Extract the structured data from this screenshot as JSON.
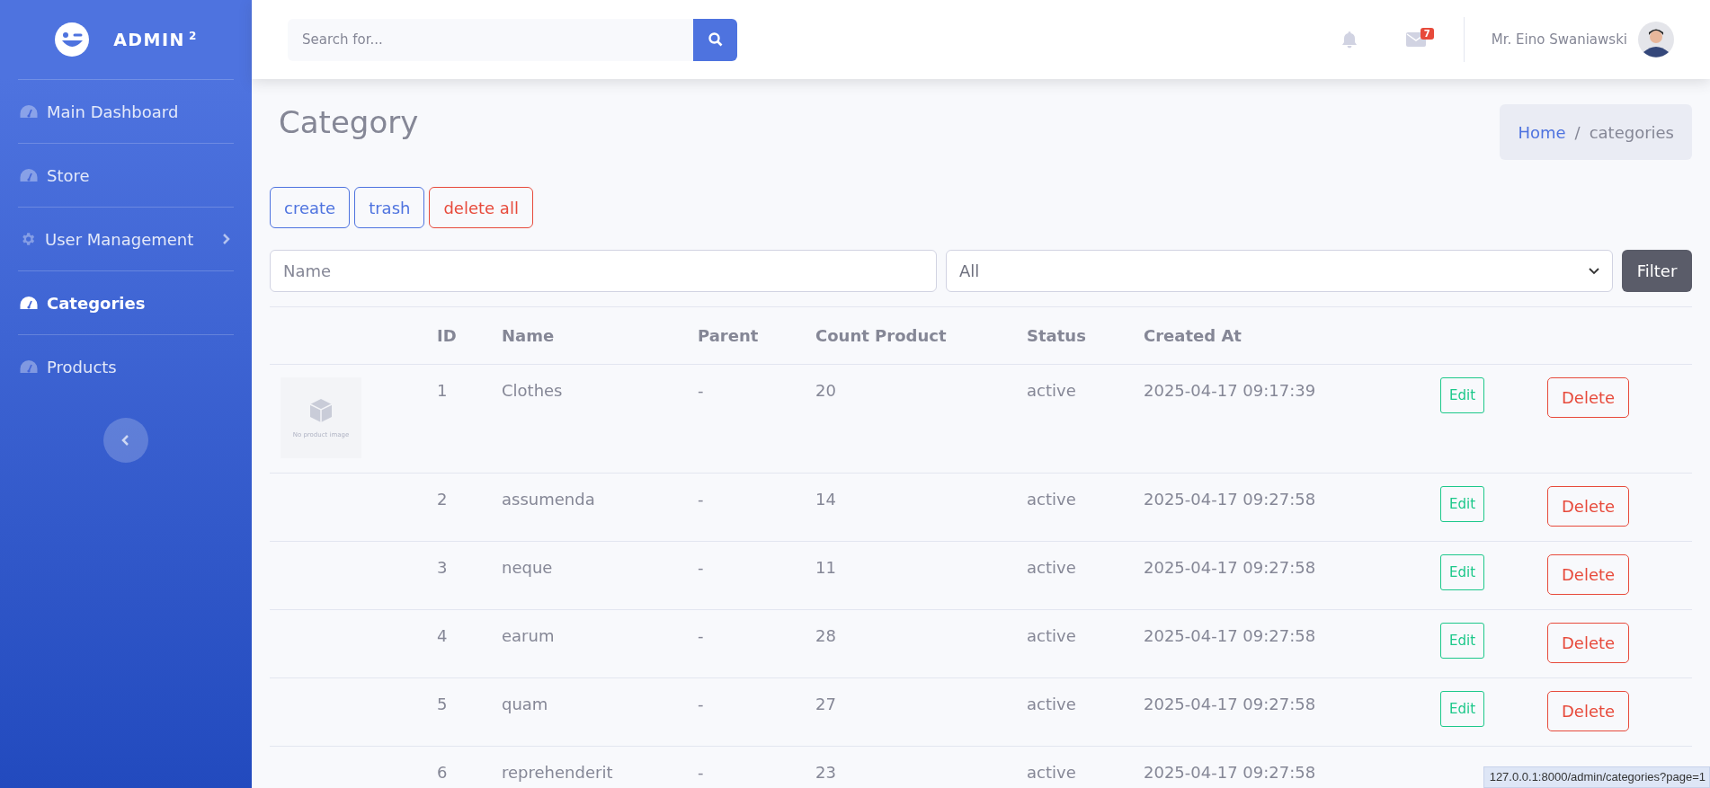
{
  "sidebar": {
    "brand": "ADMIN",
    "brand_sup": "2",
    "items": [
      {
        "label": "Main Dashboard",
        "kind": "gauge",
        "selected": false,
        "submenu": false
      },
      {
        "label": "Store",
        "kind": "gauge",
        "selected": false,
        "submenu": false
      },
      {
        "label": "User Management",
        "kind": "gear",
        "selected": false,
        "submenu": true
      },
      {
        "label": "Categories",
        "kind": "gauge",
        "selected": true,
        "submenu": false
      },
      {
        "label": "Products",
        "kind": "gauge",
        "selected": false,
        "submenu": false
      }
    ]
  },
  "topbar": {
    "search": {
      "placeholder": "Search for..."
    },
    "messages_badge": "7",
    "user_name": "Mr. Eino Swaniawski"
  },
  "page": {
    "title": "Category",
    "separator": "/",
    "breadcrumb": [
      {
        "label": "Home",
        "link": true
      },
      {
        "label": "categories",
        "link": false
      }
    ]
  },
  "actions": [
    {
      "label": "create",
      "kind": "primary"
    },
    {
      "label": "trash",
      "kind": "primary"
    },
    {
      "label": "delete all",
      "kind": "danger"
    }
  ],
  "filter": {
    "name": {
      "placeholder": "Name"
    },
    "status": {
      "value": "All"
    },
    "button": "Filter"
  },
  "table": {
    "columns": [
      "ID",
      "Name",
      "Parent",
      "Count Product",
      "Status",
      "Created At"
    ],
    "rows": [
      {
        "image": "No product image",
        "id": "1",
        "name": "Clothes",
        "parent": "-",
        "count": "20",
        "status": "active",
        "created": "2025-04-17 09:17:39",
        "edit": "Edit",
        "delete": "Delete"
      },
      {
        "id": "2",
        "name": "assumenda",
        "parent": "-",
        "count": "14",
        "status": "active",
        "created": "2025-04-17 09:27:58",
        "edit": "Edit",
        "delete": "Delete"
      },
      {
        "id": "3",
        "name": "neque",
        "parent": "-",
        "count": "11",
        "status": "active",
        "created": "2025-04-17 09:27:58",
        "edit": "Edit",
        "delete": "Delete"
      },
      {
        "id": "4",
        "name": "earum",
        "parent": "-",
        "count": "28",
        "status": "active",
        "created": "2025-04-17 09:27:58",
        "edit": "Edit",
        "delete": "Delete"
      },
      {
        "id": "5",
        "name": "quam",
        "parent": "-",
        "count": "27",
        "status": "active",
        "created": "2025-04-17 09:27:58",
        "edit": "Edit",
        "delete": "Delete"
      },
      {
        "id": "6",
        "name": "reprehenderit",
        "parent": "-",
        "count": "23",
        "status": "active",
        "created": "2025-04-17 09:27:58"
      }
    ]
  },
  "status_bar": {
    "url": "127.0.0.1:8000/admin/categories?page=1"
  }
}
